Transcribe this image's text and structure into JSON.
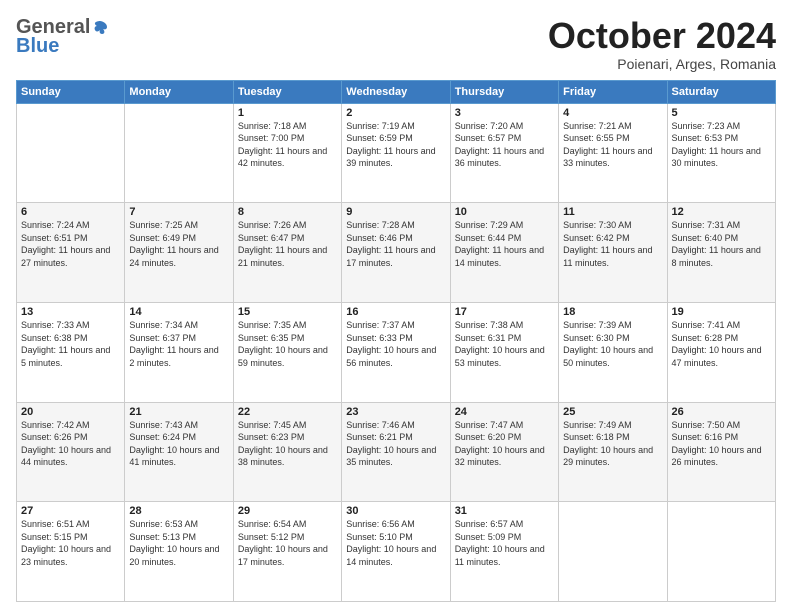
{
  "logo": {
    "general": "General",
    "blue": "Blue"
  },
  "title": "October 2024",
  "location": "Poienari, Arges, Romania",
  "days_of_week": [
    "Sunday",
    "Monday",
    "Tuesday",
    "Wednesday",
    "Thursday",
    "Friday",
    "Saturday"
  ],
  "weeks": [
    [
      {
        "day": "",
        "info": ""
      },
      {
        "day": "",
        "info": ""
      },
      {
        "day": "1",
        "info": "Sunrise: 7:18 AM\nSunset: 7:00 PM\nDaylight: 11 hours and 42 minutes."
      },
      {
        "day": "2",
        "info": "Sunrise: 7:19 AM\nSunset: 6:59 PM\nDaylight: 11 hours and 39 minutes."
      },
      {
        "day": "3",
        "info": "Sunrise: 7:20 AM\nSunset: 6:57 PM\nDaylight: 11 hours and 36 minutes."
      },
      {
        "day": "4",
        "info": "Sunrise: 7:21 AM\nSunset: 6:55 PM\nDaylight: 11 hours and 33 minutes."
      },
      {
        "day": "5",
        "info": "Sunrise: 7:23 AM\nSunset: 6:53 PM\nDaylight: 11 hours and 30 minutes."
      }
    ],
    [
      {
        "day": "6",
        "info": "Sunrise: 7:24 AM\nSunset: 6:51 PM\nDaylight: 11 hours and 27 minutes."
      },
      {
        "day": "7",
        "info": "Sunrise: 7:25 AM\nSunset: 6:49 PM\nDaylight: 11 hours and 24 minutes."
      },
      {
        "day": "8",
        "info": "Sunrise: 7:26 AM\nSunset: 6:47 PM\nDaylight: 11 hours and 21 minutes."
      },
      {
        "day": "9",
        "info": "Sunrise: 7:28 AM\nSunset: 6:46 PM\nDaylight: 11 hours and 17 minutes."
      },
      {
        "day": "10",
        "info": "Sunrise: 7:29 AM\nSunset: 6:44 PM\nDaylight: 11 hours and 14 minutes."
      },
      {
        "day": "11",
        "info": "Sunrise: 7:30 AM\nSunset: 6:42 PM\nDaylight: 11 hours and 11 minutes."
      },
      {
        "day": "12",
        "info": "Sunrise: 7:31 AM\nSunset: 6:40 PM\nDaylight: 11 hours and 8 minutes."
      }
    ],
    [
      {
        "day": "13",
        "info": "Sunrise: 7:33 AM\nSunset: 6:38 PM\nDaylight: 11 hours and 5 minutes."
      },
      {
        "day": "14",
        "info": "Sunrise: 7:34 AM\nSunset: 6:37 PM\nDaylight: 11 hours and 2 minutes."
      },
      {
        "day": "15",
        "info": "Sunrise: 7:35 AM\nSunset: 6:35 PM\nDaylight: 10 hours and 59 minutes."
      },
      {
        "day": "16",
        "info": "Sunrise: 7:37 AM\nSunset: 6:33 PM\nDaylight: 10 hours and 56 minutes."
      },
      {
        "day": "17",
        "info": "Sunrise: 7:38 AM\nSunset: 6:31 PM\nDaylight: 10 hours and 53 minutes."
      },
      {
        "day": "18",
        "info": "Sunrise: 7:39 AM\nSunset: 6:30 PM\nDaylight: 10 hours and 50 minutes."
      },
      {
        "day": "19",
        "info": "Sunrise: 7:41 AM\nSunset: 6:28 PM\nDaylight: 10 hours and 47 minutes."
      }
    ],
    [
      {
        "day": "20",
        "info": "Sunrise: 7:42 AM\nSunset: 6:26 PM\nDaylight: 10 hours and 44 minutes."
      },
      {
        "day": "21",
        "info": "Sunrise: 7:43 AM\nSunset: 6:24 PM\nDaylight: 10 hours and 41 minutes."
      },
      {
        "day": "22",
        "info": "Sunrise: 7:45 AM\nSunset: 6:23 PM\nDaylight: 10 hours and 38 minutes."
      },
      {
        "day": "23",
        "info": "Sunrise: 7:46 AM\nSunset: 6:21 PM\nDaylight: 10 hours and 35 minutes."
      },
      {
        "day": "24",
        "info": "Sunrise: 7:47 AM\nSunset: 6:20 PM\nDaylight: 10 hours and 32 minutes."
      },
      {
        "day": "25",
        "info": "Sunrise: 7:49 AM\nSunset: 6:18 PM\nDaylight: 10 hours and 29 minutes."
      },
      {
        "day": "26",
        "info": "Sunrise: 7:50 AM\nSunset: 6:16 PM\nDaylight: 10 hours and 26 minutes."
      }
    ],
    [
      {
        "day": "27",
        "info": "Sunrise: 6:51 AM\nSunset: 5:15 PM\nDaylight: 10 hours and 23 minutes."
      },
      {
        "day": "28",
        "info": "Sunrise: 6:53 AM\nSunset: 5:13 PM\nDaylight: 10 hours and 20 minutes."
      },
      {
        "day": "29",
        "info": "Sunrise: 6:54 AM\nSunset: 5:12 PM\nDaylight: 10 hours and 17 minutes."
      },
      {
        "day": "30",
        "info": "Sunrise: 6:56 AM\nSunset: 5:10 PM\nDaylight: 10 hours and 14 minutes."
      },
      {
        "day": "31",
        "info": "Sunrise: 6:57 AM\nSunset: 5:09 PM\nDaylight: 10 hours and 11 minutes."
      },
      {
        "day": "",
        "info": ""
      },
      {
        "day": "",
        "info": ""
      }
    ]
  ]
}
